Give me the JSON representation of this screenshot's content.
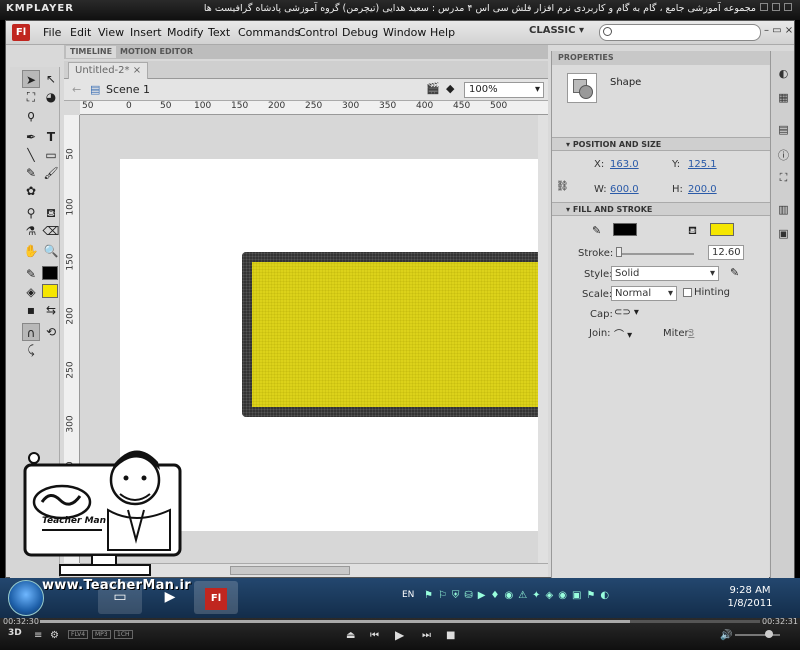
{
  "player": {
    "logo": "KMPLAYER",
    "caption": "مجموعه آموزشی جامع ، گام به گام و کاربردی نرم افزار فلش سی اس ۴ مدرس : سعید هدایی (تیچرمن) گروه آموزشی پادشاه گرافیست ها"
  },
  "app": {
    "logo": "Fl",
    "workspace": "CLASSIC",
    "search_placeholder": ""
  },
  "menu": [
    "File",
    "Edit",
    "View",
    "Insert",
    "Modify",
    "Text",
    "Commands",
    "Control",
    "Debug",
    "Window",
    "Help"
  ],
  "panel_tabs": [
    "TIMELINE",
    "MOTION EDITOR"
  ],
  "document": {
    "tab": "Untitled-2*",
    "close": "×",
    "scene": "Scene 1",
    "zoom": "100%"
  },
  "ruler": {
    "top": [
      "50",
      "0",
      "50",
      "100",
      "150",
      "200",
      "250",
      "300",
      "350",
      "400",
      "450",
      "500"
    ],
    "left": [
      "50",
      "100",
      "150",
      "200",
      "250",
      "300",
      "350"
    ]
  },
  "properties": {
    "header": "PROPERTIES",
    "object_type": "Shape",
    "position_size": {
      "title": "POSITION AND SIZE",
      "x_label": "X:",
      "x": "163.0",
      "y_label": "Y:",
      "y": "125.1",
      "w_label": "W:",
      "w": "600.0",
      "h_label": "H:",
      "h": "200.0"
    },
    "fill_stroke": {
      "title": "FILL AND STROKE",
      "stroke_color": "#000000",
      "fill_color": "#f5e600",
      "stroke_label": "Stroke:",
      "stroke_value": "12.60",
      "style_label": "Style:",
      "style": "Solid",
      "scale_label": "Scale:",
      "scale": "Normal",
      "hinting": "Hinting",
      "cap_label": "Cap:",
      "join_label": "Join:",
      "miter_label": "Miter:",
      "miter": "3"
    }
  },
  "taskbar": {
    "lang": "EN",
    "time": "9:28 AM",
    "date": "1/8/2011",
    "watermark": "www.TeacherMan.ir"
  },
  "player_controls": {
    "elapsed": "00:32:30",
    "total": "00:32:31",
    "badges": [
      "FLV4",
      "MP3",
      "1CH"
    ],
    "label_3d": "3D"
  }
}
